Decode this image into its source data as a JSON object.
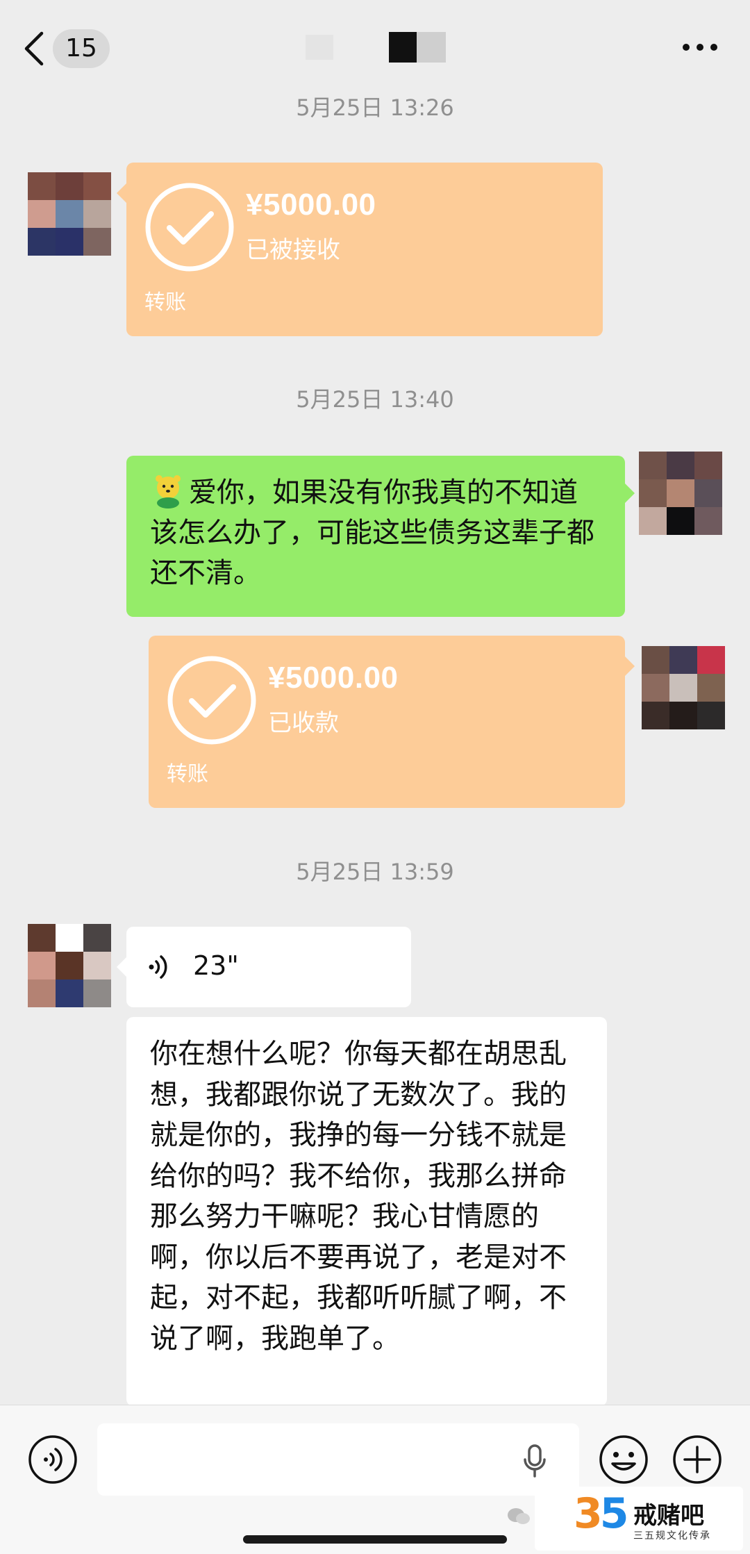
{
  "header": {
    "unread_count": "15",
    "back_icon": "chevron-left-icon",
    "more_icon": "more-horizontal-icon"
  },
  "timestamps": [
    "5月25日 13:26",
    "5月25日 13:40",
    "5月25日 13:59"
  ],
  "messages": [
    {
      "type": "transfer",
      "side": "left",
      "amount": "¥5000.00",
      "status": "已被接收",
      "label": "转账"
    },
    {
      "type": "text",
      "side": "right",
      "emoji": "bear-emoji",
      "text": "爱你，如果没有你我真的不知道该怎么办了，可能这些债务这辈子都还不清。"
    },
    {
      "type": "transfer",
      "side": "right",
      "amount": "¥5000.00",
      "status": "已收款",
      "label": "转账"
    },
    {
      "type": "voice",
      "side": "left",
      "duration": "23\""
    },
    {
      "type": "text",
      "side": "left",
      "text": "你在想什么呢？你每天都在胡思乱想，我都跟你说了无数次了。我的就是你的，我挣的每一分钱不就是给你的吗？我不给你，我那么拼命那么努力干嘛呢？我心甘情愿的啊，你以后不要再说了，老是对不起，对不起，我都听听腻了啊，不说了啊，我跑单了。"
    }
  ],
  "input_bar": {
    "voice_toggle_icon": "voice-toggle-icon",
    "mic_icon": "microphone-icon",
    "emoji_icon": "emoji-icon",
    "plus_icon": "plus-icon"
  },
  "watermark": {
    "logo": "35",
    "name": "戒赌吧",
    "subtitle": "三五规文化传承"
  },
  "colors": {
    "background": "#ededed",
    "transfer_orange": "#fdcc98",
    "sent_green": "#95ec69",
    "received_white": "#ffffff"
  }
}
